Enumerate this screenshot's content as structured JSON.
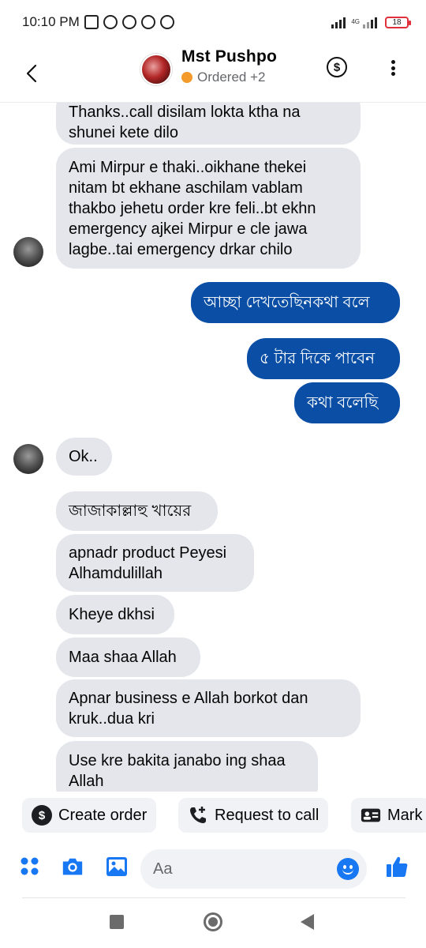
{
  "status_bar": {
    "time": "10:10 PM",
    "network": "4G",
    "battery": "18"
  },
  "header": {
    "name": "Mst Pushpo",
    "status": "Ordered +2",
    "icons": [
      "back-arrow-icon",
      "dollar-icon",
      "more-vertical-icon"
    ]
  },
  "messages": [
    {
      "dir": "in",
      "text": "Thanks..call disilam lokta ktha na shunei kete dilo"
    },
    {
      "dir": "in",
      "text": "Ami Mirpur e thaki..oikhane thekei nitam bt ekhane aschilam vablam thakbo jehetu order kre feli..bt ekhn emergency ajkei Mirpur e cle jawa lagbe..tai emergency drkar chilo"
    },
    {
      "dir": "out",
      "text": "আচ্ছা দেখতেছিনকথা বলে"
    },
    {
      "dir": "out",
      "text": "৫ টার দিকে পাবেন"
    },
    {
      "dir": "out",
      "text": "কথা বলেছি"
    },
    {
      "dir": "in",
      "text": "Ok.."
    },
    {
      "dir": "in",
      "text": "জাজাকাল্লাহু খায়ের"
    },
    {
      "dir": "in",
      "text": "apnadr product Peyesi Alhamdulillah"
    },
    {
      "dir": "in",
      "text": "Kheye dkhsi"
    },
    {
      "dir": "in",
      "text": "Maa shaa Allah"
    },
    {
      "dir": "in",
      "text": "Apnar business e Allah borkot dan kruk..dua kri"
    },
    {
      "dir": "in",
      "text": "Use kre bakita janabo ing shaa Allah"
    }
  ],
  "quick_actions": [
    {
      "label": "Create order",
      "icon": "dollar-circle-icon"
    },
    {
      "label": "Request to call",
      "icon": "phone-plus-icon"
    },
    {
      "label": "Mark",
      "icon": "contact-card-icon"
    }
  ],
  "composer": {
    "placeholder": "Aa",
    "icons": [
      "apps-icon",
      "camera-icon",
      "image-icon",
      "emoji-icon",
      "thumbs-up-icon"
    ]
  },
  "colors": {
    "outgoing_bubble": "#0a4ea5",
    "incoming_bubble": "#e4e6eb",
    "accent": "#1877f2",
    "status_dot": "#f39a2b"
  }
}
